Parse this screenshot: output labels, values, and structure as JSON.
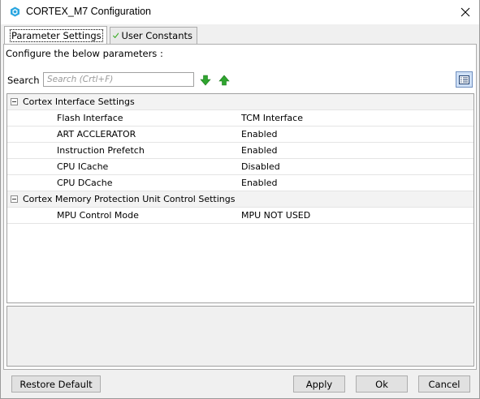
{
  "window": {
    "title": "CORTEX_M7 Configuration",
    "close_glyph": "✕"
  },
  "tabs": [
    {
      "label": "Parameter Settings",
      "icon": "green-check-icon",
      "active": true
    },
    {
      "label": "User Constants",
      "icon": "green-check-icon",
      "active": false
    }
  ],
  "parameters_panel": {
    "intro": "Configure the below parameters :",
    "search": {
      "label": "Search :",
      "placeholder": "Search (Crtl+F)",
      "value": ""
    },
    "groups": [
      {
        "label": "Cortex Interface Settings",
        "expanded": true,
        "items": [
          {
            "name": "Flash Interface",
            "value": "TCM Interface"
          },
          {
            "name": "ART ACCLERATOR",
            "value": "Enabled"
          },
          {
            "name": "Instruction Prefetch",
            "value": "Enabled"
          },
          {
            "name": "CPU ICache",
            "value": "Disabled"
          },
          {
            "name": "CPU DCache",
            "value": "Enabled"
          }
        ]
      },
      {
        "label": "Cortex Memory Protection Unit Control Settings",
        "expanded": true,
        "items": [
          {
            "name": "MPU Control Mode",
            "value": "MPU NOT USED"
          }
        ]
      }
    ]
  },
  "buttons": {
    "restore_default": "Restore Default",
    "apply": "Apply",
    "ok": "Ok",
    "cancel": "Cancel"
  },
  "colors": {
    "check_green": "#3fae2a",
    "arrow_green": "#2fa52f",
    "title_icon_blue": "#2aa6e0",
    "view_button_blue": "#cfe0f6"
  }
}
